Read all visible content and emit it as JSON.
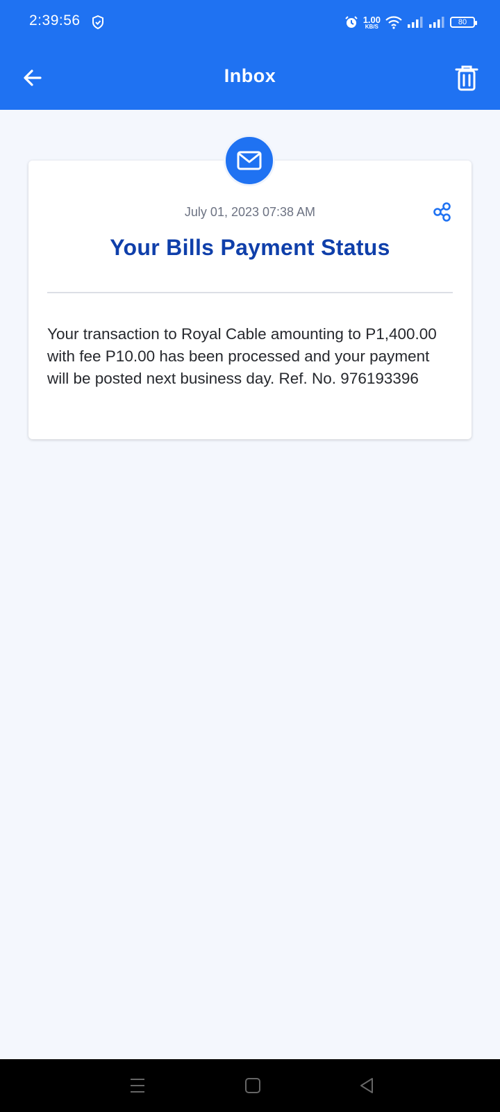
{
  "status_bar": {
    "time": "2:39:56",
    "net_speed_value": "1.00",
    "net_speed_unit": "KB/S",
    "battery": "80"
  },
  "header": {
    "title": "Inbox",
    "back_icon": "arrow-left-icon",
    "delete_icon": "trash-icon",
    "color": "#1f72f2"
  },
  "message": {
    "icon": "envelope-icon",
    "date": "July 01, 2023 07:38 AM",
    "title": "Your Bills Payment Status",
    "body": "Your transaction to Royal Cable amounting to P1,400.00 with fee P10.00 has been processed and your payment will be posted next business day. Ref. No. 976193396",
    "share_icon": "share-icon",
    "title_color": "#0f3faa"
  },
  "nav_bar": {
    "menu_icon": "menu-icon",
    "home_icon": "home-icon",
    "back_icon": "back-triangle-icon"
  }
}
